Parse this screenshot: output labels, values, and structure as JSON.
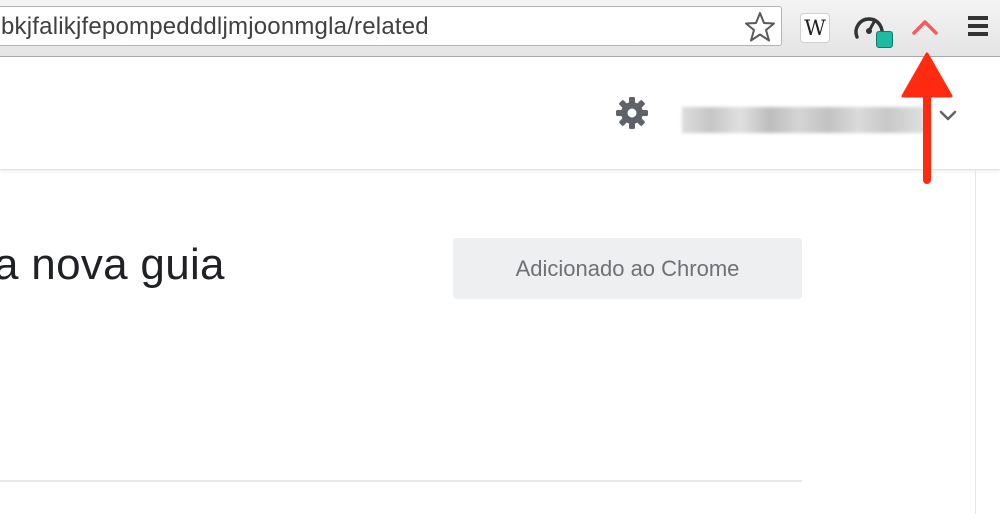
{
  "browser": {
    "address_bar": {
      "url_text": "bkjfalikjfepompedddljmjoonmgla/related"
    },
    "toolbar_icons": [
      "star-icon",
      "wikipedia-extension-icon",
      "speed-gauge-icon",
      "red-arrow-extension-icon",
      "hamburger-menu-icon"
    ],
    "extension_letter": "W"
  },
  "header": {
    "icons": [
      "gear-icon",
      "chevron-down-icon"
    ],
    "account_name": ""
  },
  "main": {
    "title": "a nova guia",
    "added_button_label": "Adicionado ao Chrome"
  },
  "annotation": {
    "color": "#ff2a0f",
    "points_to": "red-arrow-extension-icon"
  },
  "colors": {
    "accent_red": "#f25c5c",
    "badge_teal": "#1cbca3",
    "button_bg": "#eeeff0"
  }
}
